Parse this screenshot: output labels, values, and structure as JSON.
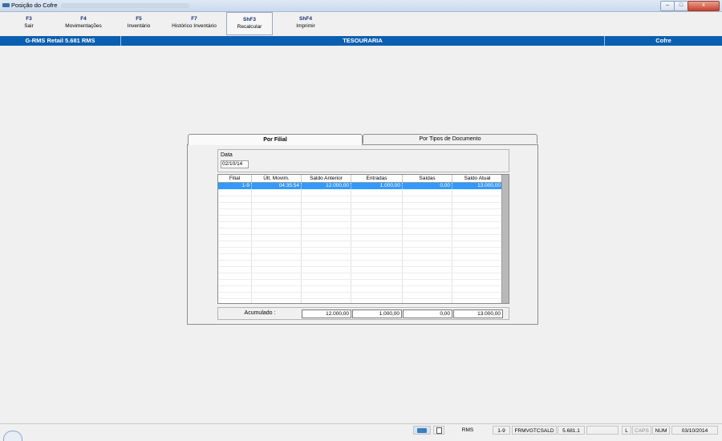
{
  "window": {
    "title": "Posição do Cofre",
    "controls": {
      "minimize": "–",
      "maximize": "□",
      "close": "x"
    }
  },
  "toolbar": {
    "keys": [
      {
        "key": "F3",
        "label": "Sair"
      },
      {
        "key": "F4",
        "label": "Movimentações"
      },
      {
        "key": "F5",
        "label": "Inventário"
      },
      {
        "key": "F7",
        "label": "Histórico Inventário"
      },
      {
        "key": "ShF3",
        "label": "Recalcular"
      },
      {
        "key": "ShF4",
        "label": "Imprimir"
      }
    ]
  },
  "header": {
    "system": "G-RMS Retail 5.681 RMS",
    "module": "TESOURARIA",
    "screen": "Cofre"
  },
  "tabs": [
    {
      "label": "Por Filial",
      "active": true
    },
    {
      "label": "Por Tipos de Documento",
      "active": false
    }
  ],
  "filter": {
    "date_label": "Data",
    "date_value": "02/10/14"
  },
  "grid": {
    "columns": [
      "Filial",
      "Últ. Movim.",
      "Saldo Anterior",
      "Entradas",
      "Saídas",
      "Saldo Atual"
    ],
    "rows": [
      [
        "1-9",
        "04:35:54",
        "12.000,00",
        "1.000,00",
        "0,00",
        "13.000,00"
      ]
    ]
  },
  "totals": {
    "label": "Acumulado :",
    "values": [
      "12.000,00",
      "1.000,00",
      "0,00",
      "13.000,00"
    ]
  },
  "statusbar": {
    "items": [
      "RMS",
      "1-9",
      "FRMVGTCSALD",
      "5.681.1",
      "",
      "L",
      "CAPS",
      "NUM",
      "03/10/2014"
    ]
  },
  "colors": {
    "header_bg": "#0b5fb0",
    "selection": "#3399ff",
    "fkey_text": "#1c2c72"
  }
}
